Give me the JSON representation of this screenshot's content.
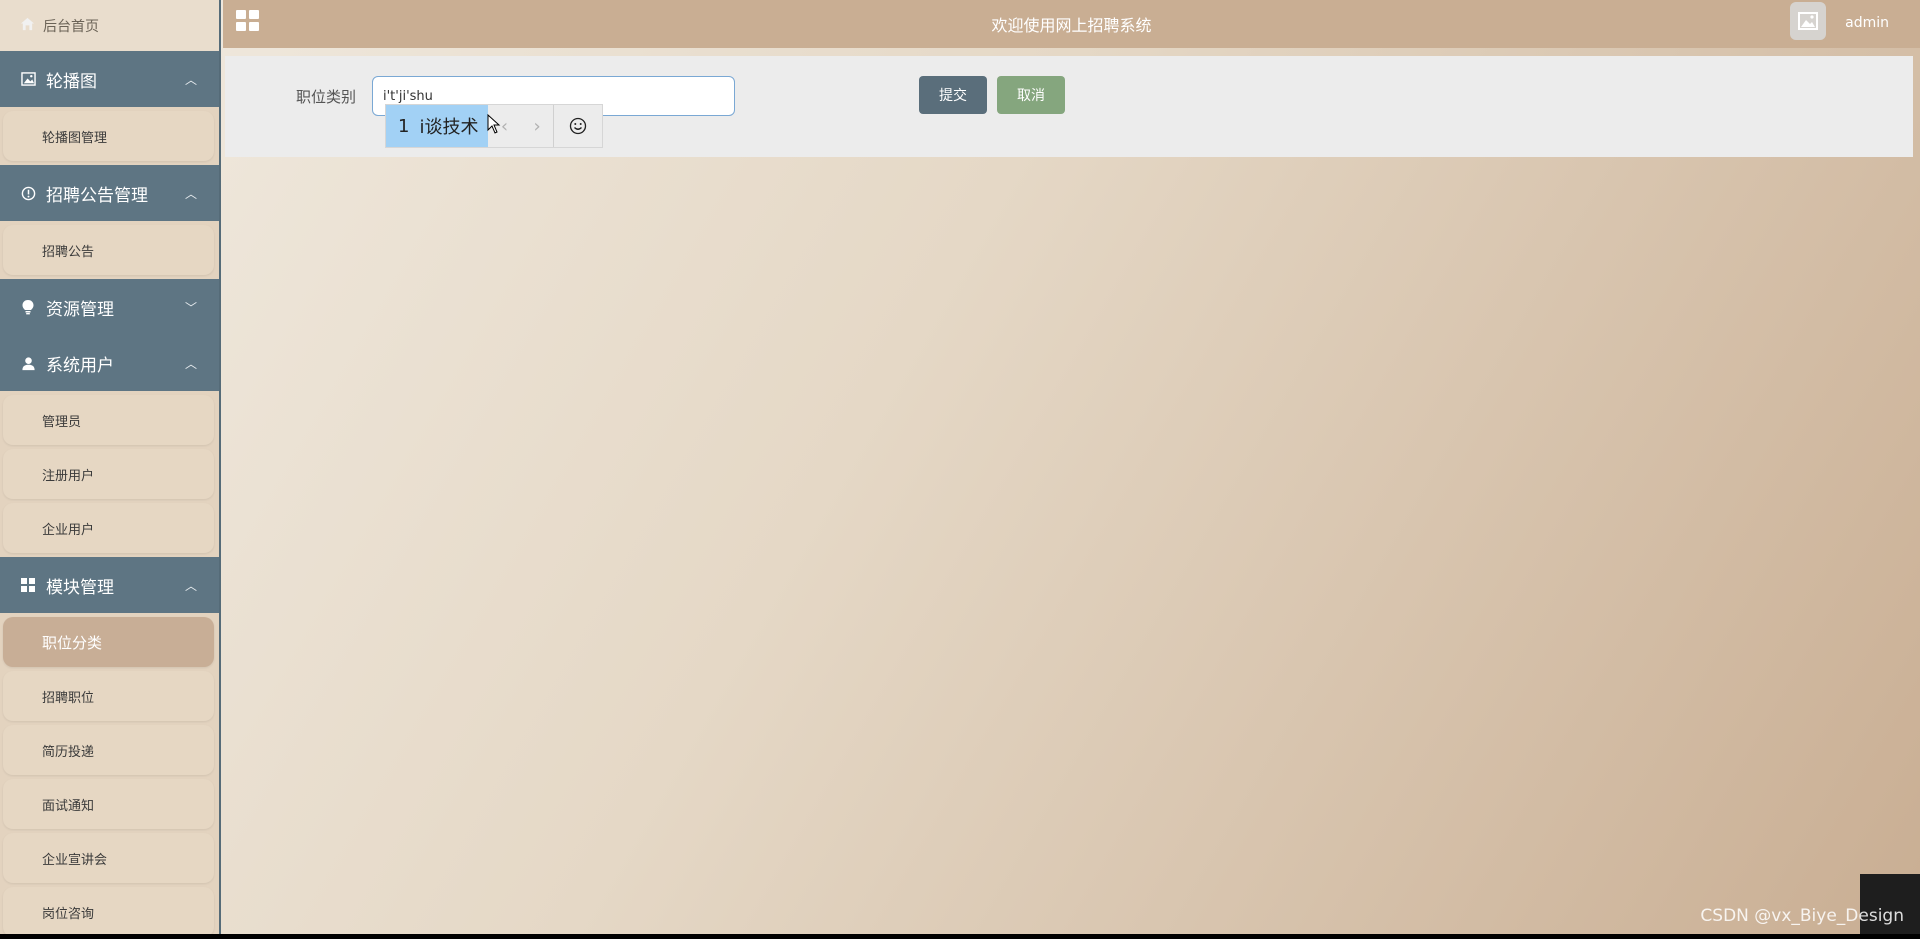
{
  "header": {
    "title": "欢迎使用网上招聘系统",
    "username": "admin"
  },
  "sidebar": {
    "home": "后台首页",
    "groups": [
      {
        "label": "轮播图",
        "icon": "image-icon",
        "expanded": true,
        "items": [
          "轮播图管理"
        ]
      },
      {
        "label": "招聘公告管理",
        "icon": "info-circle-icon",
        "expanded": true,
        "items": [
          "招聘公告"
        ]
      },
      {
        "label": "资源管理",
        "icon": "lightbulb-icon",
        "expanded": false,
        "items": []
      },
      {
        "label": "系统用户",
        "icon": "user-icon",
        "expanded": true,
        "items": [
          "管理员",
          "注册用户",
          "企业用户"
        ]
      },
      {
        "label": "模块管理",
        "icon": "grid-icon",
        "expanded": true,
        "items": [
          "职位分类",
          "招聘职位",
          "简历投递",
          "面试通知",
          "企业宣讲会",
          "岗位咨询"
        ],
        "active": "职位分类"
      }
    ]
  },
  "form": {
    "field_label": "职位类别",
    "field_value": "i't'ji'shu",
    "submit_label": "提交",
    "cancel_label": "取消"
  },
  "ime": {
    "candidate_number": "1",
    "candidate_text": "i谈技术"
  },
  "watermark": "CSDN @vx_Biye_Design",
  "colors": {
    "sidebar_group": "#5e7583",
    "topbar": "#c9ae93",
    "submit": "#5a6e7b",
    "cancel": "#85a67e"
  }
}
